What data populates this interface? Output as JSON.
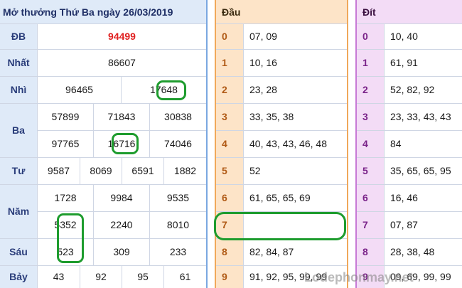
{
  "title": "Mở thưởng Thứ Ba ngày 26/03/2019",
  "prizes": {
    "db": {
      "label": "ĐB",
      "value": "94499",
      "color": "#e02020"
    },
    "nhat": {
      "label": "Nhất",
      "value": "86607"
    },
    "nhi": {
      "label": "Nhì",
      "values": [
        "96465",
        "17648"
      ]
    },
    "ba": {
      "label": "Ba",
      "rows": [
        [
          "57899",
          "71843",
          "30838"
        ],
        [
          "97765",
          "16716",
          "74046"
        ]
      ]
    },
    "tu": {
      "label": "Tư",
      "values": [
        "9587",
        "8069",
        "6591",
        "1882"
      ]
    },
    "nam": {
      "label": "Năm",
      "rows": [
        [
          "1728",
          "9984",
          "9535"
        ],
        [
          "5352",
          "2240",
          "8010"
        ]
      ]
    },
    "sau": {
      "label": "Sáu",
      "values": [
        "523",
        "309",
        "233"
      ]
    },
    "bay": {
      "label": "Bảy",
      "values": [
        "43",
        "92",
        "95",
        "61"
      ]
    }
  },
  "dau": {
    "header": "Đầu",
    "rows": [
      {
        "k": "0",
        "v": "07, 09"
      },
      {
        "k": "1",
        "v": "10, 16"
      },
      {
        "k": "2",
        "v": "23, 28"
      },
      {
        "k": "3",
        "v": "33, 35, 38"
      },
      {
        "k": "4",
        "v": "40, 43, 43, 46, 48"
      },
      {
        "k": "5",
        "v": "52"
      },
      {
        "k": "6",
        "v": "61, 65, 65, 69"
      },
      {
        "k": "7",
        "v": ""
      },
      {
        "k": "8",
        "v": "82, 84, 87"
      },
      {
        "k": "9",
        "v": "91, 92, 95, 99, 99"
      }
    ]
  },
  "dit": {
    "header": "Đít",
    "rows": [
      {
        "k": "0",
        "v": "10, 40"
      },
      {
        "k": "1",
        "v": "61, 91"
      },
      {
        "k": "2",
        "v": "52, 82, 92"
      },
      {
        "k": "3",
        "v": "23, 33, 43, 43"
      },
      {
        "k": "4",
        "v": "84"
      },
      {
        "k": "5",
        "v": "35, 65, 65, 95"
      },
      {
        "k": "6",
        "v": "16, 46"
      },
      {
        "k": "7",
        "v": "07, 87"
      },
      {
        "k": "8",
        "v": "28, 38, 48"
      },
      {
        "k": "9",
        "v": "09, 69, 99, 99"
      }
    ]
  },
  "watermark": "Lodephonmay.net",
  "colors": {
    "accent_blue": "#dfeaf8",
    "accent_orange": "#fde4c8",
    "accent_purple": "#f3dcf6",
    "highlight_green": "#1e9c2e"
  }
}
